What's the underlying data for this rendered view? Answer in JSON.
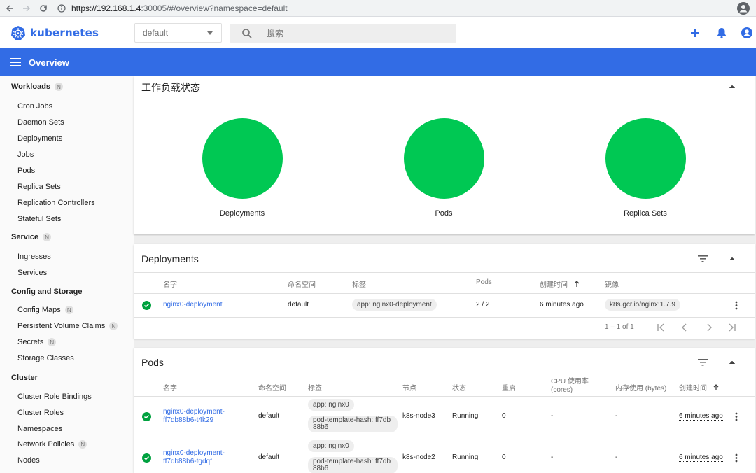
{
  "browser": {
    "url_host": "https://192.168.1.4",
    "url_rest": ":30005/#/overview?namespace=default"
  },
  "header": {
    "logo_text": "kubernetes",
    "namespace": "default",
    "search_placeholder": "搜索"
  },
  "toolbar": {
    "title": "Overview"
  },
  "sidebar": {
    "badge": "N",
    "workloads": "Workloads",
    "workload_items": [
      "Cron Jobs",
      "Daemon Sets",
      "Deployments",
      "Jobs",
      "Pods",
      "Replica Sets",
      "Replication Controllers",
      "Stateful Sets"
    ],
    "service": "Service",
    "service_items": [
      "Ingresses",
      "Services"
    ],
    "config": "Config and Storage",
    "config_items": [
      "Config Maps",
      "Persistent Volume Claims",
      "Secrets",
      "Storage Classes"
    ],
    "cluster": "Cluster",
    "cluster_items": [
      "Cluster Role Bindings",
      "Cluster Roles",
      "Namespaces",
      "Network Policies",
      "Nodes"
    ]
  },
  "workload_status": {
    "title": "工作负载状态",
    "charts": [
      {
        "label": "Deployments",
        "running_fraction": 1.0
      },
      {
        "label": "Pods",
        "running_fraction": 1.0
      },
      {
        "label": "Replica Sets",
        "running_fraction": 1.0
      }
    ],
    "color_running": "#00c853"
  },
  "deployments": {
    "title": "Deployments",
    "headers": [
      "名字",
      "命名空间",
      "标签",
      "Pods",
      "创建时间",
      "镜像"
    ],
    "rows": [
      {
        "name": "nginx0-deployment",
        "namespace": "default",
        "label": "app: nginx0-deployment",
        "pods": "2 / 2",
        "created": "6 minutes ago",
        "image": "k8s.gcr.io/nginx:1.7.9"
      }
    ],
    "pagination": "1 – 1 of 1"
  },
  "pods": {
    "title": "Pods",
    "headers": [
      "名字",
      "命名空间",
      "标签",
      "节点",
      "状态",
      "重启",
      "CPU 使用率",
      "(cores)",
      "内存使用 (bytes)",
      "创建时间"
    ],
    "rows": [
      {
        "name1": "nginx0-deployment-",
        "name2": "ff7db88b6-t4k29",
        "namespace": "default",
        "label1": "app: nginx0",
        "label2a": "pod-template-hash: ff7db",
        "label2b": "88b6",
        "node": "k8s-node3",
        "status": "Running",
        "restarts": "0",
        "cpu": "-",
        "mem": "-",
        "created": "6 minutes ago"
      },
      {
        "name1": "nginx0-deployment-",
        "name2": "ff7db88b6-tgdqf",
        "namespace": "default",
        "label1": "app: nginx0",
        "label2a": "pod-template-hash: ff7db",
        "label2b": "88b6",
        "node": "k8s-node2",
        "status": "Running",
        "restarts": "0",
        "cpu": "-",
        "mem": "-",
        "created": "6 minutes ago"
      }
    ]
  },
  "colors": {
    "brand": "#326ce5",
    "success": "#00a13f"
  }
}
